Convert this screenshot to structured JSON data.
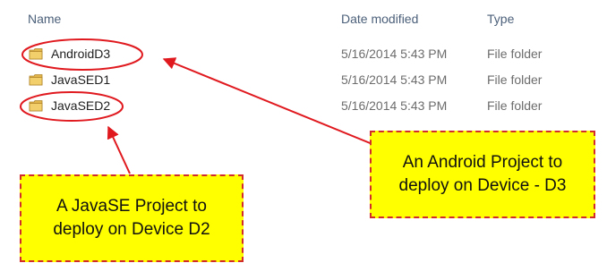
{
  "columns": {
    "name": "Name",
    "date_modified": "Date modified",
    "type": "Type"
  },
  "rows": [
    {
      "name": "AndroidD3",
      "date": "5/16/2014 5:43 PM",
      "type": "File folder",
      "icon": "folder-icon"
    },
    {
      "name": "JavaSED1",
      "date": "5/16/2014 5:43 PM",
      "type": "File folder",
      "icon": "folder-icon"
    },
    {
      "name": "JavaSED2",
      "date": "5/16/2014 5:43 PM",
      "type": "File folder",
      "icon": "folder-icon"
    }
  ],
  "annotations": {
    "android": "An Android Project to\ndeploy on Device - D3",
    "javase": "A JavaSE Project to\ndeploy on Device D2"
  },
  "colors": {
    "callout_fill": "#ffff00",
    "callout_border": "#d22b2b",
    "arrow": "#e0191f"
  }
}
